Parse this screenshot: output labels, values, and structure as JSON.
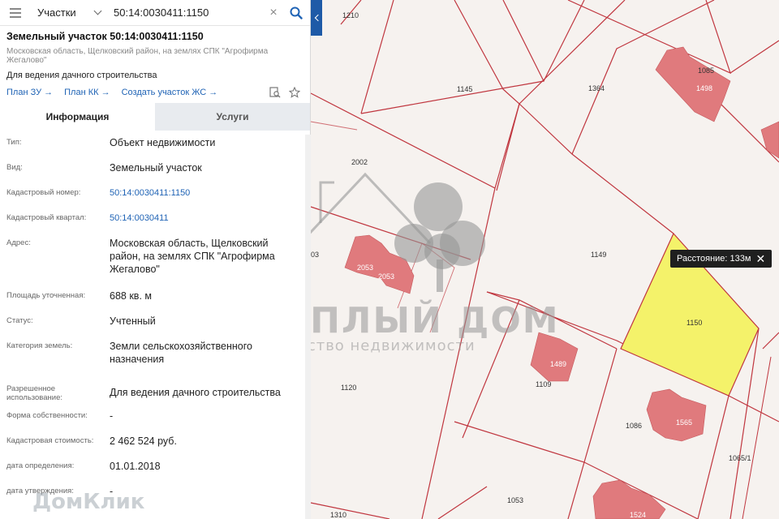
{
  "search": {
    "type_label": "Участки",
    "query": "50:14:0030411:1150"
  },
  "header": {
    "title": "Земельный участок 50:14:0030411:1150",
    "address": "Московская область, Щелковский район, на землях СПК \"Агрофирма Жегалово\"",
    "use": "Для ведения дачного строительства",
    "links": [
      "План ЗУ →",
      "План КК →",
      "Создать участок ЖС →"
    ]
  },
  "tabs": [
    "Информация",
    "Услуги"
  ],
  "properties": [
    {
      "key": "Тип:",
      "value": "Объект недвижимости"
    },
    {
      "key": "Вид:",
      "value": "Земельный участок"
    },
    {
      "key": "Кадастровый номер:",
      "value": "50:14:0030411:1150",
      "link": true
    },
    {
      "key": "Кадастровый квартал:",
      "value": "50:14:0030411",
      "link": true
    },
    {
      "key": "Адрес:",
      "value": "Московская область, Щелковский район, на землях СПК \"Агрофирма Жегалово\""
    },
    {
      "key": "Площадь уточненная:",
      "value": "688 кв. м"
    },
    {
      "key": "Статус:",
      "value": "Учтенный"
    },
    {
      "key": "Категория земель:",
      "value": "Земли сельскохозяйственного назначения"
    },
    {
      "key": "Разрешенное использование:",
      "value": "Для ведения дачного строительства"
    },
    {
      "key": "Форма собственности:",
      "value": "-"
    },
    {
      "key": "Кадастровая стоимость:",
      "value": "2 462 524 руб."
    },
    {
      "key": "дата определения:",
      "value": "01.01.2018"
    },
    {
      "key": "дата утверждения:",
      "value": "-"
    }
  ],
  "map": {
    "distance_tip": "Расстояние: 133м",
    "plot_labels": [
      "1210",
      "1085",
      "1498",
      "1145",
      "1364",
      "2002",
      "1149",
      "1150",
      "1489",
      "1109",
      "1120",
      "1086",
      "1565",
      "1065/1",
      "1053",
      "1310",
      "1524",
      "03"
    ],
    "building_labels": [
      "2053",
      "2053"
    ],
    "watermark_title": "ТЁПЛЫЙ ДОМ",
    "watermark_sub": "агентство недвижимости",
    "watermark_brand": "ДомКлик"
  },
  "colors": {
    "plot_line": "#c0363f",
    "building": "#e07a7d",
    "selected_plot": "#f4f26a",
    "accent": "#1f63b5",
    "collapse_tab": "#1e5aa7"
  }
}
